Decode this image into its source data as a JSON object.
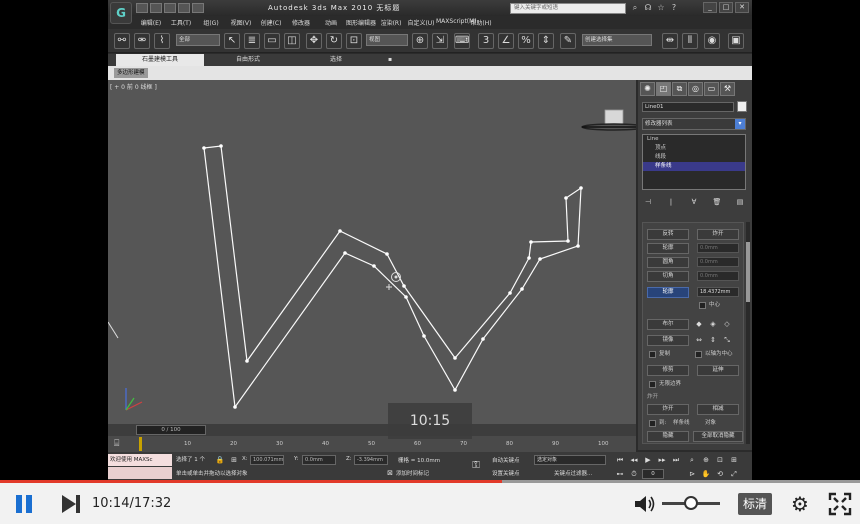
{
  "app": {
    "title": "Autodesk 3ds Max  2010    无标题",
    "logo_glyph": "G",
    "search_placeholder": "键入关键字或短语",
    "menu": [
      "编辑(E)",
      "工具(T)",
      "组(G)",
      "视图(V)",
      "创建(C)",
      "修改器",
      "动画",
      "图形编辑器",
      "渲染(R)",
      "自定义(U)",
      "MAXScript(M)",
      "帮助(H)"
    ],
    "toolbar": {
      "selection_filter": "全部",
      "ref_coord": "视图",
      "named_selection": "创建选择集"
    },
    "ribbon_tabs": [
      "石墨建模工具",
      "自由形式",
      "选择"
    ],
    "ribbon_panel_label": "多边形建模",
    "viewport_label": "[ + 0 前 0 线框 ]"
  },
  "command_panel": {
    "object_name": "Line01",
    "modifier_list": "修改器列表",
    "stack": [
      {
        "label": "Line",
        "level": 0,
        "selected": false
      },
      {
        "label": "顶点",
        "level": 1,
        "selected": false
      },
      {
        "label": "线段",
        "level": 1,
        "selected": false
      },
      {
        "label": "样条线",
        "level": 1,
        "selected": true
      }
    ],
    "rollout": {
      "reverse": "反转",
      "outline": "轮廓",
      "boolean": "布尔",
      "mirror": "镜像",
      "trim": "修剪",
      "extend": "延伸",
      "hide": "隐藏",
      "unhide_all": "全部取消隐藏",
      "explode": "炸开",
      "subtract": "相减",
      "copy": "复制",
      "about_pivot": "以轴为中心",
      "infinite_bounds": "无限边界",
      "center": "中心",
      "label_1": "轮廓",
      "label_2": "圆角",
      "label_3": "切角",
      "outline_value": "18.4372mm",
      "spinner_value": "0.0mm",
      "section_title": "炸开",
      "to_label": "到:",
      "spline_label": "样条线",
      "object_label": "对象"
    }
  },
  "timeline": {
    "position": "0 / 100",
    "ticks": [
      "10",
      "20",
      "30",
      "40",
      "50",
      "60",
      "70",
      "80",
      "90",
      "100"
    ]
  },
  "status": {
    "welcome": "欢迎使用 MAXSc",
    "selected": "选择了 1 个",
    "prompt": "单击或单击并拖动以选择对象",
    "x_label": "X:",
    "x_value": "100.071mm",
    "y_label": "Y:",
    "y_value": "0.0mm",
    "z_label": "Z:",
    "z_value": "-3.394mm",
    "grid": "栅格 = 10.0mm",
    "add_time_tag": "添加时间标记",
    "auto_key": "自动关键点",
    "set_key": "设置关键点",
    "selected_set": "选定对象",
    "key_filters": "关键点过滤器...",
    "frame": "0"
  },
  "overlay_time": "10:15",
  "player": {
    "current": "10:14",
    "total": "17:32",
    "time_display": "10:14/17:32",
    "progress": 0.584,
    "volume": 0.55,
    "quality": "标清"
  }
}
